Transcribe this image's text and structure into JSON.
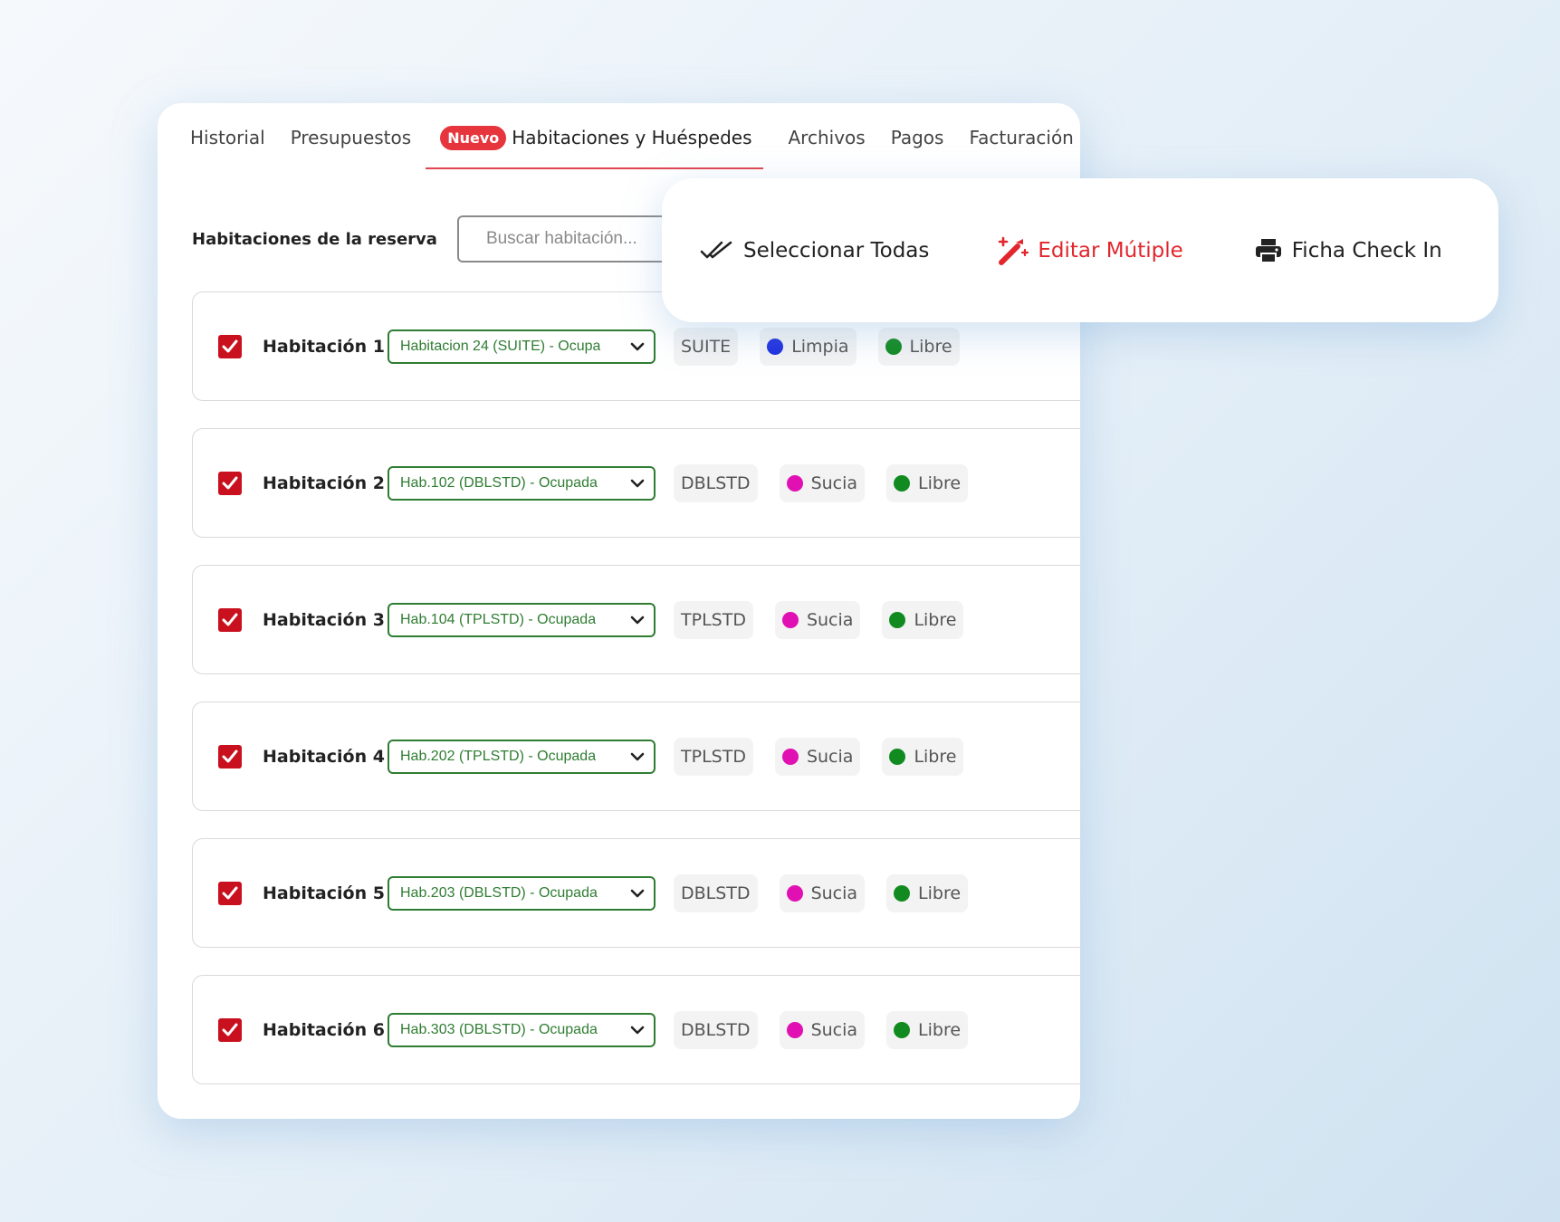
{
  "tabs": {
    "items": [
      {
        "label": "Historial"
      },
      {
        "label": "Presupuestos"
      },
      {
        "label": "Habitaciones y Huéspedes",
        "badge": "Nuevo",
        "active": true
      },
      {
        "label": "Archivos"
      },
      {
        "label": "Pagos"
      },
      {
        "label": "Facturación"
      }
    ]
  },
  "search": {
    "label": "Habitaciones de la reserva",
    "placeholder": "Buscar habitación..."
  },
  "toolbar": {
    "select_all": "Seleccionar Todas",
    "edit_multiple": "Editar Mútiple",
    "checkin_sheet": "Ficha Check In"
  },
  "colors": {
    "accent_red": "#e1262d",
    "checkbox_red": "#c8101e",
    "select_green": "#2f7d32",
    "clean_blue": "#1f2fe0",
    "dirty_magenta": "#e010b3",
    "free_green": "#118a1f"
  },
  "rooms": [
    {
      "label": "Habitación 1",
      "checked": true,
      "select": "Habitacion 24 (SUITE) - Ocupa",
      "type": "SUITE",
      "cleaning": "Limpia",
      "cleaning_color": "#1f2fe0",
      "status": "Libre"
    },
    {
      "label": "Habitación 2",
      "checked": true,
      "select": "Hab.102 (DBLSTD) - Ocupada",
      "type": "DBLSTD",
      "cleaning": "Sucia",
      "cleaning_color": "#e010b3",
      "status": "Libre"
    },
    {
      "label": "Habitación 3",
      "checked": true,
      "select": "Hab.104 (TPLSTD) - Ocupada",
      "type": "TPLSTD",
      "cleaning": "Sucia",
      "cleaning_color": "#e010b3",
      "status": "Libre"
    },
    {
      "label": "Habitación 4",
      "checked": true,
      "select": "Hab.202 (TPLSTD) - Ocupada",
      "type": "TPLSTD",
      "cleaning": "Sucia",
      "cleaning_color": "#e010b3",
      "status": "Libre"
    },
    {
      "label": "Habitación 5",
      "checked": true,
      "select": "Hab.203 (DBLSTD) - Ocupada",
      "type": "DBLSTD",
      "cleaning": "Sucia",
      "cleaning_color": "#e010b3",
      "status": "Libre"
    },
    {
      "label": "Habitación 6",
      "checked": true,
      "select": "Hab.303 (DBLSTD) - Ocupada",
      "type": "DBLSTD",
      "cleaning": "Sucia",
      "cleaning_color": "#e010b3",
      "status": "Libre"
    }
  ]
}
